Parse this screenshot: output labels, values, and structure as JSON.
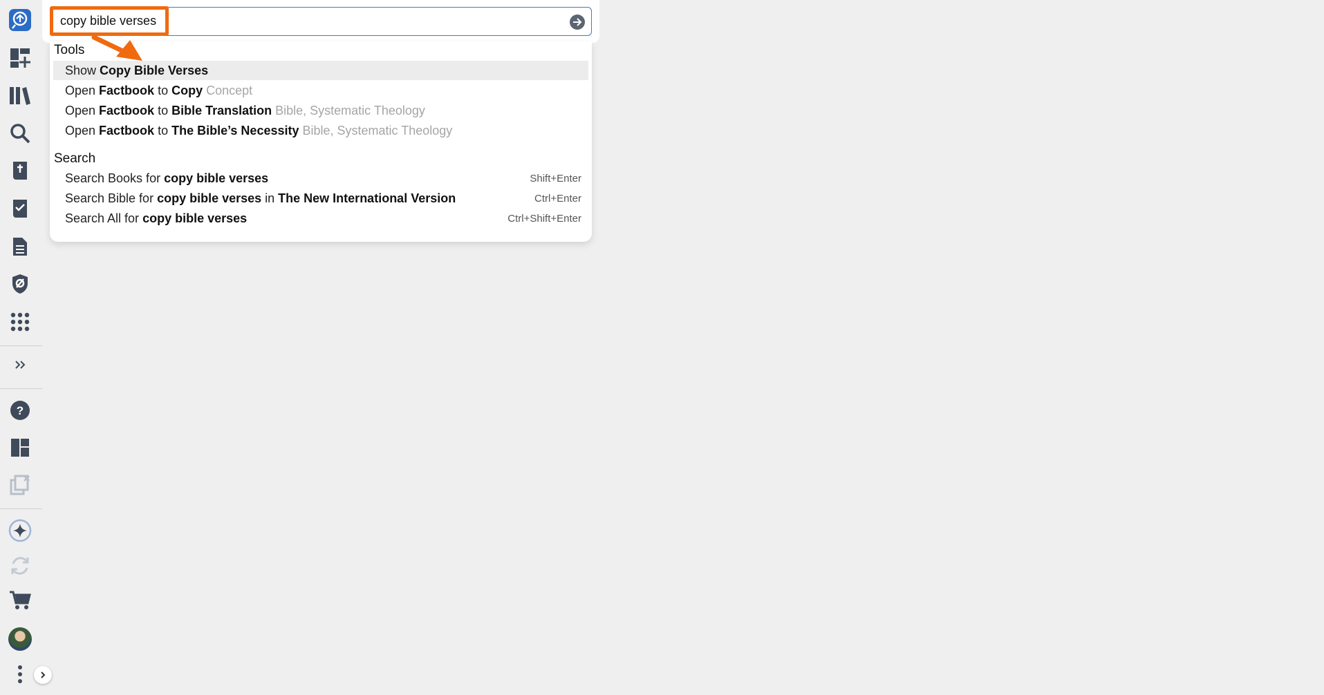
{
  "search": {
    "query": "copy bible verses"
  },
  "dropdown": {
    "tools_heading": "Tools",
    "search_heading": "Search",
    "tools": [
      {
        "prefix": "Show ",
        "bold": "Copy Bible Verses",
        "middle": "",
        "bold2": "",
        "muted": ""
      },
      {
        "prefix": "Open ",
        "bold": "Factbook",
        "middle": " to ",
        "bold2": "Copy",
        "muted": "Concept"
      },
      {
        "prefix": "Open ",
        "bold": "Factbook",
        "middle": " to ",
        "bold2": "Bible Translation",
        "muted": "Bible, Systematic Theology"
      },
      {
        "prefix": "Open ",
        "bold": "Factbook",
        "middle": " to ",
        "bold2": "The Bible’s Necessity",
        "muted": "Bible, Systematic Theology"
      }
    ],
    "searches": [
      {
        "prefix": "Search Books for ",
        "bold": "copy bible verses",
        "middle": "",
        "bold2": "",
        "shortcut": "Shift+Enter"
      },
      {
        "prefix": "Search Bible for ",
        "bold": "copy bible verses",
        "middle": " in ",
        "bold2": "The New International Version",
        "shortcut": "Ctrl+Enter"
      },
      {
        "prefix": "Search All for ",
        "bold": "copy bible verses",
        "middle": "",
        "bold2": "",
        "shortcut": "Ctrl+Shift+Enter"
      }
    ]
  },
  "colors": {
    "accent": "#2b6cc4",
    "highlight": "#f06a0f",
    "icon": "#3f4a5a"
  },
  "sidebar_icons": [
    "logos-logo-icon",
    "add-layout-icon",
    "library-icon",
    "search-icon",
    "bible-icon",
    "checklist-icon",
    "document-icon",
    "shield-icon",
    "apps-grid-icon",
    "expand-icon",
    "help-icon",
    "layouts-icon",
    "close-panels-icon",
    "ai-sparkle-icon",
    "sync-icon",
    "cart-icon",
    "avatar",
    "more-icon"
  ]
}
